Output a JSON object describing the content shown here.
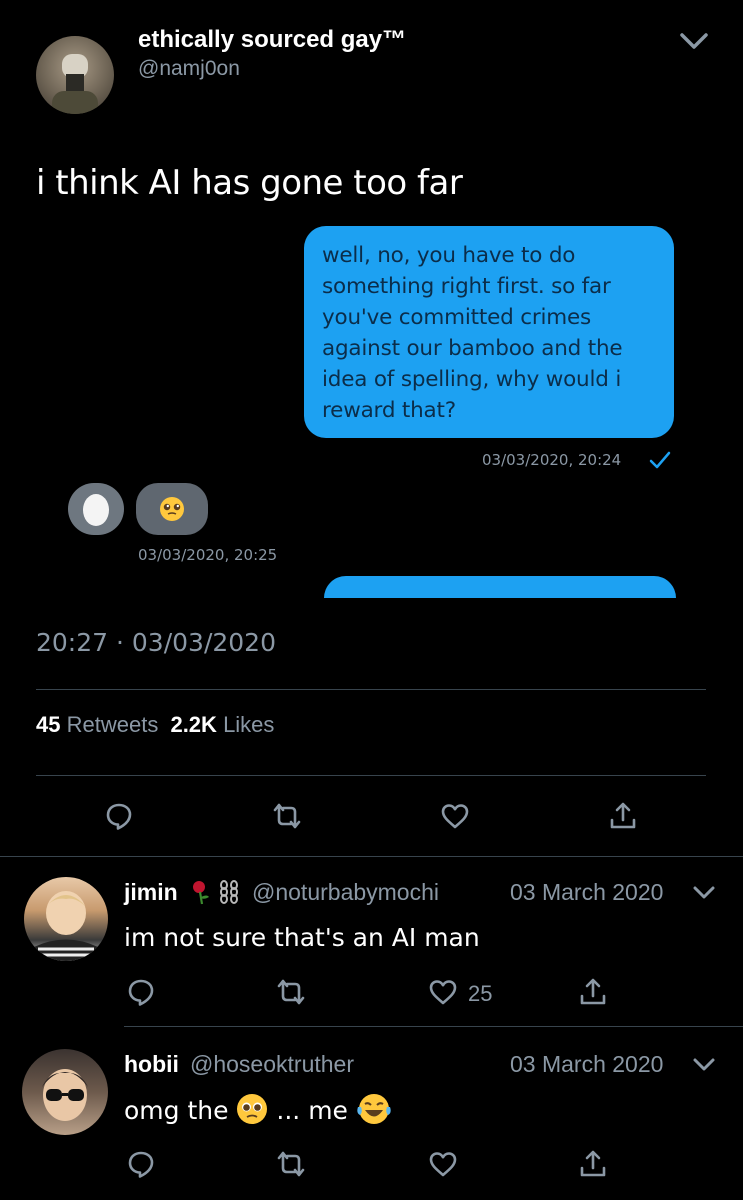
{
  "tweet": {
    "display_name": "ethically sourced gay™",
    "handle": "@namj0on",
    "text": "i think AI has gone too far",
    "timestamp": "20:27",
    "separator": "·",
    "date": "03/03/2020",
    "retweets_count": "45",
    "retweets_label": "Retweets",
    "likes_count": "2.2K",
    "likes_label": "Likes"
  },
  "dm": {
    "sent_message": "well, no, you have to do something right first. so far you've committed crimes against our bamboo and the idea of spelling, why would i reward that?",
    "sent_timestamp": "03/03/2020, 20:24",
    "received_timestamp": "03/03/2020, 20:25"
  },
  "replies": [
    {
      "name": "jimin",
      "handle": "@noturbabymochi",
      "date": "03 March 2020",
      "text": "im not sure that's an AI man",
      "likes": "25"
    },
    {
      "name": "hobii",
      "handle": "@hoseoktruther",
      "date": "03 March 2020",
      "text_part1": "omg the",
      "text_part2": "... me"
    }
  ],
  "colors": {
    "background": "#000000",
    "bubble_blue": "#1da1f2",
    "muted": "#8b98a5",
    "divider": "#38444d"
  },
  "icons": [
    "chevron-down-icon",
    "reply-icon",
    "retweet-icon",
    "like-icon",
    "share-icon",
    "read-check-icon"
  ]
}
